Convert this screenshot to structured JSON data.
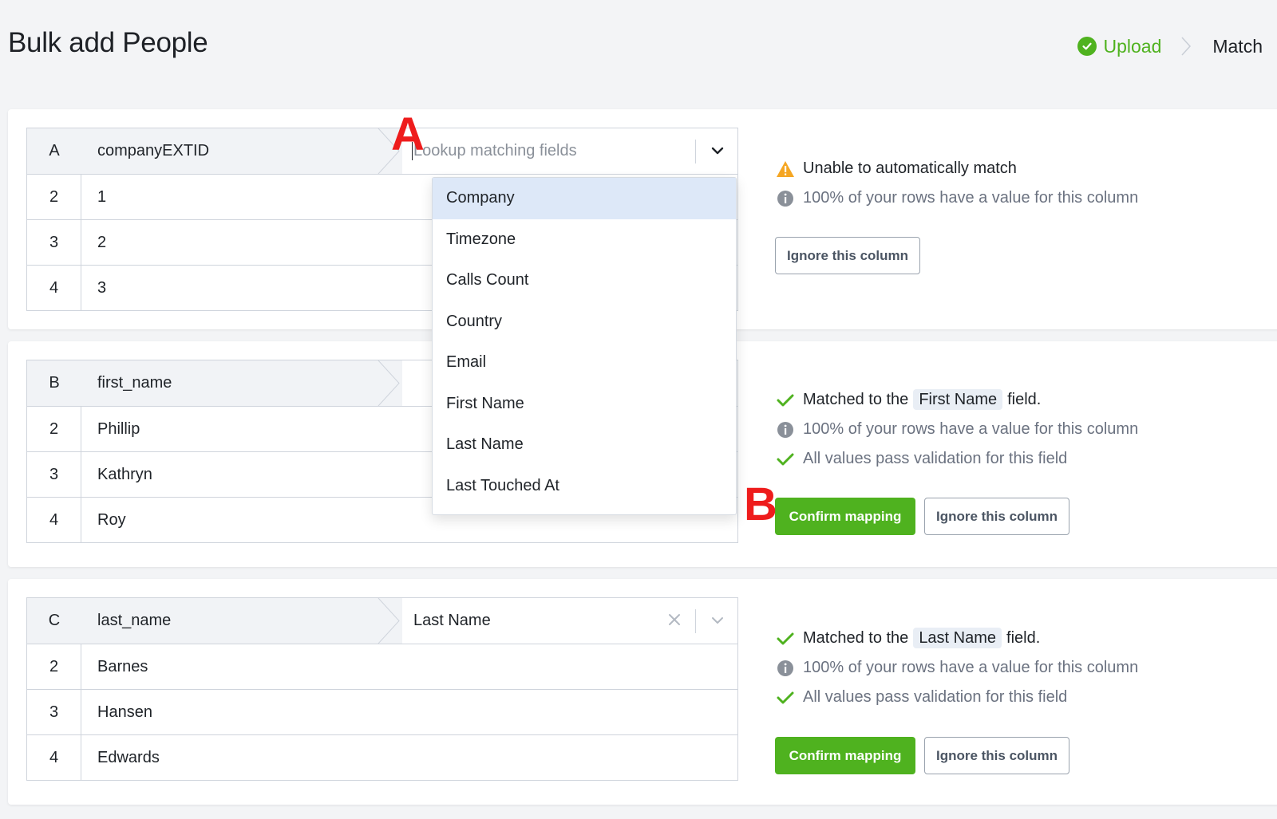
{
  "page": {
    "title": "Bulk add People",
    "steps": [
      {
        "label": "Upload",
        "state": "done",
        "color": "#4fb21f"
      },
      {
        "label": "Match",
        "state": "current"
      }
    ]
  },
  "columns": [
    {
      "letter": "A",
      "header": "companyEXTID",
      "rows": [
        {
          "num": "2",
          "value": "1"
        },
        {
          "num": "3",
          "value": "2"
        },
        {
          "num": "4",
          "value": "3"
        }
      ],
      "select": {
        "placeholder": "Lookup matching fields",
        "value": "",
        "open": true
      },
      "status": {
        "title": "Unable to automatically match",
        "fill_text": "100% of your rows have a value for this column"
      },
      "buttons": {
        "ignore": "Ignore this column"
      }
    },
    {
      "letter": "B",
      "header": "first_name",
      "rows": [
        {
          "num": "2",
          "value": "Phillip"
        },
        {
          "num": "3",
          "value": "Kathryn"
        },
        {
          "num": "4",
          "value": "Roy"
        }
      ],
      "status": {
        "matched_prefix": "Matched to the",
        "matched_field": "First Name",
        "matched_suffix": "field.",
        "fill_text": "100% of your rows have a value for this column",
        "validation_text": "All values pass validation for this field"
      },
      "buttons": {
        "confirm": "Confirm mapping",
        "ignore": "Ignore this column"
      }
    },
    {
      "letter": "C",
      "header": "last_name",
      "rows": [
        {
          "num": "2",
          "value": "Barnes"
        },
        {
          "num": "3",
          "value": "Hansen"
        },
        {
          "num": "4",
          "value": "Edwards"
        }
      ],
      "select": {
        "value": "Last Name"
      },
      "status": {
        "matched_prefix": "Matched to the",
        "matched_field": "Last Name",
        "matched_suffix": "field.",
        "fill_text": "100% of your rows have a value for this column",
        "validation_text": "All values pass validation for this field"
      },
      "buttons": {
        "confirm": "Confirm mapping",
        "ignore": "Ignore this column"
      }
    }
  ],
  "dropdown": {
    "options": [
      "Company",
      "Timezone",
      "Calls Count",
      "Country",
      "Email",
      "First Name",
      "Last Name",
      "Last Touched At"
    ],
    "highlighted": "Company"
  },
  "annotations": {
    "a": "A",
    "b": "B",
    "color": "#ee1c1c"
  },
  "colors": {
    "accent_green": "#4fb21f",
    "warning": "#f5a623",
    "info_grey": "#8a9099"
  }
}
